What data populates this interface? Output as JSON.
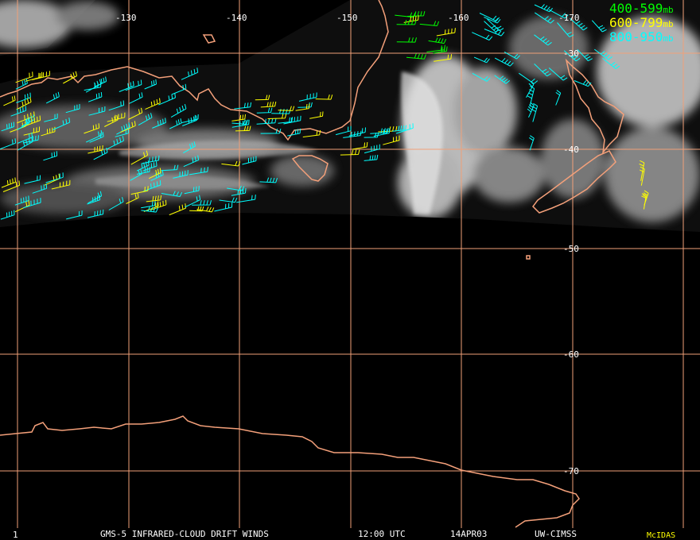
{
  "longitude_labels": [
    "-130",
    "-140",
    "-150",
    "-160",
    "-170"
  ],
  "latitude_labels": [
    "-30",
    "-40",
    "-50",
    "-60",
    "-70"
  ],
  "legend": {
    "items": [
      {
        "range": "400-599",
        "unit": "mb",
        "color": "#00ff00"
      },
      {
        "range": "600-799",
        "unit": "mb",
        "color": "#ffff00"
      },
      {
        "range": "800-950",
        "unit": "mb",
        "color": "#00ffff"
      }
    ]
  },
  "footer": {
    "frame": "1",
    "product": "GMS-5 INFRARED-CLOUD DRIFT WINDS",
    "time": "12:00 UTC",
    "date": "14APR03",
    "source": "UW-CIMSS",
    "software": "McIDAS"
  },
  "colors": {
    "grid": "#f0a078",
    "coast": "#f4a07a",
    "footer_text": "#ffffff",
    "mcidas": "#ffff00"
  },
  "imagery_note_icons": [
    "cloud-imagery",
    "wind-barb-icon"
  ]
}
